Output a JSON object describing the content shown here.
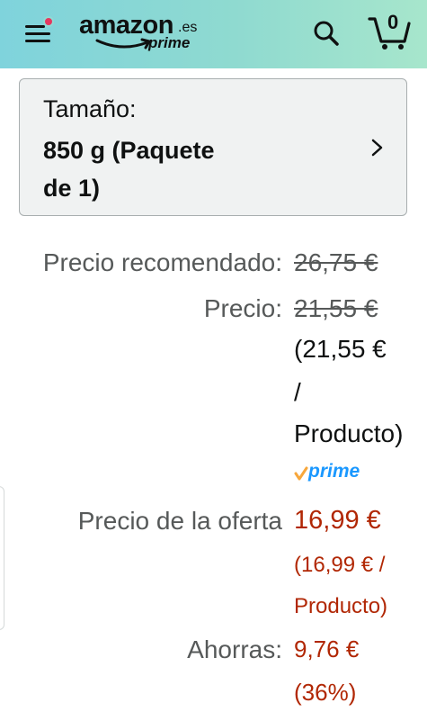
{
  "header": {
    "logo_word": "amazon",
    "logo_tld": ".es",
    "logo_sub": "prime",
    "cart_count": "0",
    "icons": {
      "menu": "hamburger-menu-icon",
      "notification": "notification-dot-icon",
      "search": "search-icon",
      "cart": "cart-icon"
    },
    "colors": {
      "notification_dot": "#e43860"
    }
  },
  "size_selector": {
    "label": "Tamaño:",
    "value_line1": "850 g (Paquete",
    "value_line2": "de 1)",
    "icon": "chevron-right-icon"
  },
  "pricing": {
    "recommended_label": "Precio recomendado:",
    "recommended_value": "26,75 €",
    "price_label": "Precio:",
    "price_value": "21,55 €",
    "unit_price_line1": "(21,55 €",
    "unit_price_line2": "/",
    "unit_price_line3": "Producto)",
    "prime_badge": "prime",
    "prime_check_icon": "prime-check-icon",
    "deal_label": "Precio de la oferta",
    "deal_value": "16,99 €",
    "deal_unit_line1": "(16,99 € /",
    "deal_unit_line2": "Producto)",
    "savings_label": "Ahorras:",
    "savings_value": "9,76 €",
    "savings_percent": "(36%)",
    "colors": {
      "deal_red": "#b12704",
      "prime_blue": "#1a98ff",
      "check_orange": "#f7a73c"
    }
  }
}
